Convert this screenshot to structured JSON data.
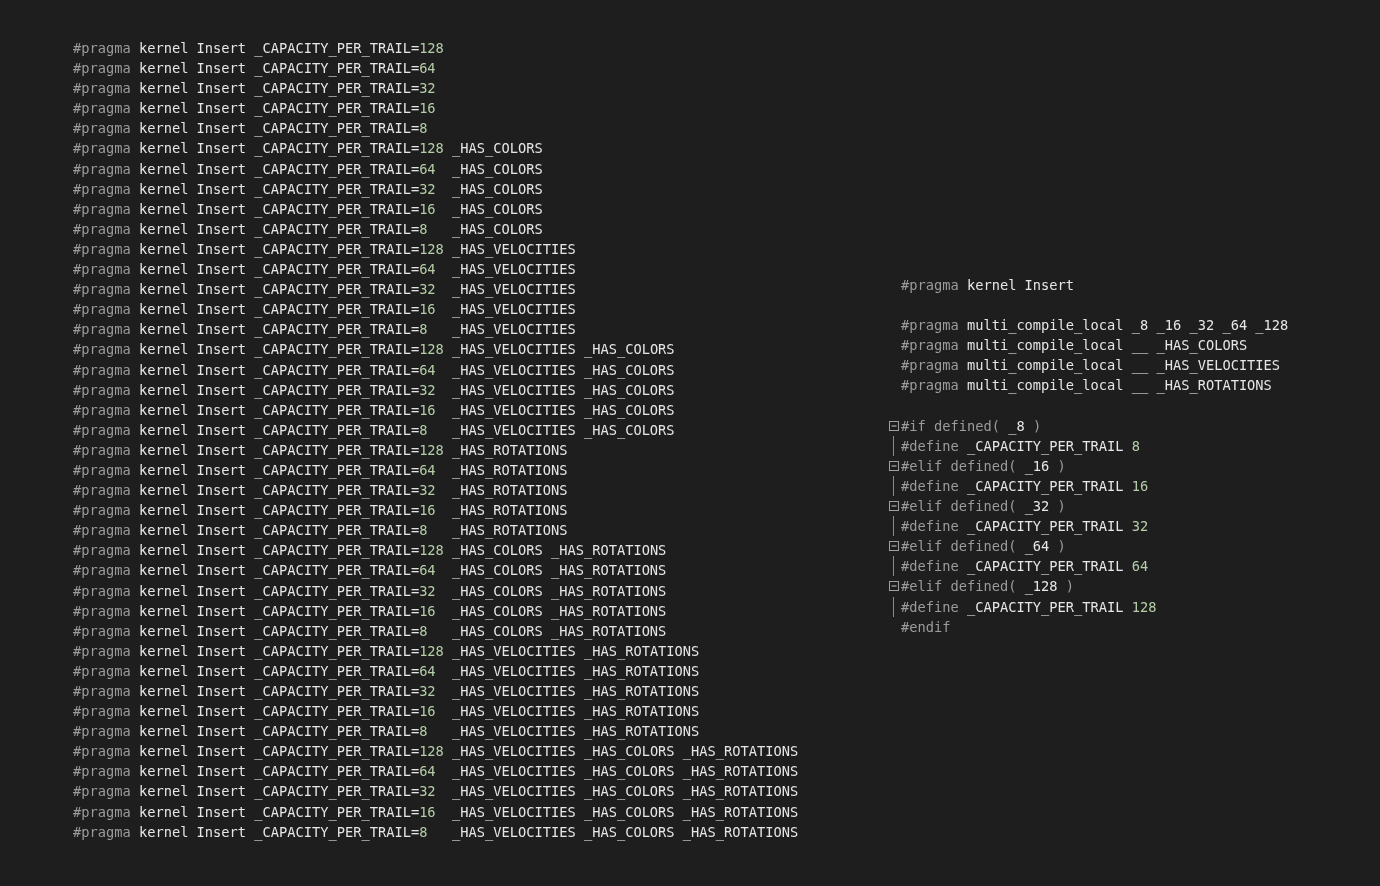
{
  "left_code": {
    "lines": [
      {
        "head": "#pragma",
        "text": "kernel Insert _CAPACITY_PER_TRAIL=",
        "value": "128"
      },
      {
        "head": "#pragma",
        "text": "kernel Insert _CAPACITY_PER_TRAIL=",
        "value": "64"
      },
      {
        "head": "#pragma",
        "text": "kernel Insert _CAPACITY_PER_TRAIL=",
        "value": "32"
      },
      {
        "head": "#pragma",
        "text": "kernel Insert _CAPACITY_PER_TRAIL=",
        "value": "16"
      },
      {
        "head": "#pragma",
        "text": "kernel Insert _CAPACITY_PER_TRAIL=",
        "value": "8"
      },
      {
        "head": "#pragma",
        "text": "kernel Insert _CAPACITY_PER_TRAIL=",
        "value": "128",
        "flags": "_HAS_COLORS"
      },
      {
        "head": "#pragma",
        "text": "kernel Insert _CAPACITY_PER_TRAIL=",
        "value": "64",
        "flags": "_HAS_COLORS"
      },
      {
        "head": "#pragma",
        "text": "kernel Insert _CAPACITY_PER_TRAIL=",
        "value": "32",
        "flags": "_HAS_COLORS"
      },
      {
        "head": "#pragma",
        "text": "kernel Insert _CAPACITY_PER_TRAIL=",
        "value": "16",
        "flags": "_HAS_COLORS"
      },
      {
        "head": "#pragma",
        "text": "kernel Insert _CAPACITY_PER_TRAIL=",
        "value": "8",
        "flags": "_HAS_COLORS"
      },
      {
        "head": "#pragma",
        "text": "kernel Insert _CAPACITY_PER_TRAIL=",
        "value": "128",
        "flags": "_HAS_VELOCITIES"
      },
      {
        "head": "#pragma",
        "text": "kernel Insert _CAPACITY_PER_TRAIL=",
        "value": "64",
        "flags": "_HAS_VELOCITIES"
      },
      {
        "head": "#pragma",
        "text": "kernel Insert _CAPACITY_PER_TRAIL=",
        "value": "32",
        "flags": "_HAS_VELOCITIES"
      },
      {
        "head": "#pragma",
        "text": "kernel Insert _CAPACITY_PER_TRAIL=",
        "value": "16",
        "flags": "_HAS_VELOCITIES"
      },
      {
        "head": "#pragma",
        "text": "kernel Insert _CAPACITY_PER_TRAIL=",
        "value": "8",
        "flags": "_HAS_VELOCITIES"
      },
      {
        "head": "#pragma",
        "text": "kernel Insert _CAPACITY_PER_TRAIL=",
        "value": "128",
        "flags": "_HAS_VELOCITIES _HAS_COLORS"
      },
      {
        "head": "#pragma",
        "text": "kernel Insert _CAPACITY_PER_TRAIL=",
        "value": "64",
        "flags": "_HAS_VELOCITIES _HAS_COLORS"
      },
      {
        "head": "#pragma",
        "text": "kernel Insert _CAPACITY_PER_TRAIL=",
        "value": "32",
        "flags": "_HAS_VELOCITIES _HAS_COLORS"
      },
      {
        "head": "#pragma",
        "text": "kernel Insert _CAPACITY_PER_TRAIL=",
        "value": "16",
        "flags": "_HAS_VELOCITIES _HAS_COLORS"
      },
      {
        "head": "#pragma",
        "text": "kernel Insert _CAPACITY_PER_TRAIL=",
        "value": "8",
        "flags": "_HAS_VELOCITIES _HAS_COLORS"
      },
      {
        "head": "#pragma",
        "text": "kernel Insert _CAPACITY_PER_TRAIL=",
        "value": "128",
        "flags": "_HAS_ROTATIONS"
      },
      {
        "head": "#pragma",
        "text": "kernel Insert _CAPACITY_PER_TRAIL=",
        "value": "64",
        "flags": "_HAS_ROTATIONS"
      },
      {
        "head": "#pragma",
        "text": "kernel Insert _CAPACITY_PER_TRAIL=",
        "value": "32",
        "flags": "_HAS_ROTATIONS"
      },
      {
        "head": "#pragma",
        "text": "kernel Insert _CAPACITY_PER_TRAIL=",
        "value": "16",
        "flags": "_HAS_ROTATIONS"
      },
      {
        "head": "#pragma",
        "text": "kernel Insert _CAPACITY_PER_TRAIL=",
        "value": "8",
        "flags": "_HAS_ROTATIONS"
      },
      {
        "head": "#pragma",
        "text": "kernel Insert _CAPACITY_PER_TRAIL=",
        "value": "128",
        "flags": "_HAS_COLORS _HAS_ROTATIONS"
      },
      {
        "head": "#pragma",
        "text": "kernel Insert _CAPACITY_PER_TRAIL=",
        "value": "64",
        "flags": "_HAS_COLORS _HAS_ROTATIONS"
      },
      {
        "head": "#pragma",
        "text": "kernel Insert _CAPACITY_PER_TRAIL=",
        "value": "32",
        "flags": "_HAS_COLORS _HAS_ROTATIONS"
      },
      {
        "head": "#pragma",
        "text": "kernel Insert _CAPACITY_PER_TRAIL=",
        "value": "16",
        "flags": "_HAS_COLORS _HAS_ROTATIONS"
      },
      {
        "head": "#pragma",
        "text": "kernel Insert _CAPACITY_PER_TRAIL=",
        "value": "8",
        "flags": "_HAS_COLORS _HAS_ROTATIONS"
      },
      {
        "head": "#pragma",
        "text": "kernel Insert _CAPACITY_PER_TRAIL=",
        "value": "128",
        "flags": "_HAS_VELOCITIES _HAS_ROTATIONS"
      },
      {
        "head": "#pragma",
        "text": "kernel Insert _CAPACITY_PER_TRAIL=",
        "value": "64",
        "flags": "_HAS_VELOCITIES _HAS_ROTATIONS"
      },
      {
        "head": "#pragma",
        "text": "kernel Insert _CAPACITY_PER_TRAIL=",
        "value": "32",
        "flags": "_HAS_VELOCITIES _HAS_ROTATIONS"
      },
      {
        "head": "#pragma",
        "text": "kernel Insert _CAPACITY_PER_TRAIL=",
        "value": "16",
        "flags": "_HAS_VELOCITIES _HAS_ROTATIONS"
      },
      {
        "head": "#pragma",
        "text": "kernel Insert _CAPACITY_PER_TRAIL=",
        "value": "8",
        "flags": "_HAS_VELOCITIES _HAS_ROTATIONS"
      },
      {
        "head": "#pragma",
        "text": "kernel Insert _CAPACITY_PER_TRAIL=",
        "value": "128",
        "flags": "_HAS_VELOCITIES _HAS_COLORS _HAS_ROTATIONS"
      },
      {
        "head": "#pragma",
        "text": "kernel Insert _CAPACITY_PER_TRAIL=",
        "value": "64",
        "flags": "_HAS_VELOCITIES _HAS_COLORS _HAS_ROTATIONS"
      },
      {
        "head": "#pragma",
        "text": "kernel Insert _CAPACITY_PER_TRAIL=",
        "value": "32",
        "flags": "_HAS_VELOCITIES _HAS_COLORS _HAS_ROTATIONS"
      },
      {
        "head": "#pragma",
        "text": "kernel Insert _CAPACITY_PER_TRAIL=",
        "value": "16",
        "flags": "_HAS_VELOCITIES _HAS_COLORS _HAS_ROTATIONS"
      },
      {
        "head": "#pragma",
        "text": "kernel Insert _CAPACITY_PER_TRAIL=",
        "value": "8",
        "flags": "_HAS_VELOCITIES _HAS_COLORS _HAS_ROTATIONS"
      }
    ]
  },
  "right_code": {
    "lines": [
      {
        "kind": "plain",
        "tokens": [
          {
            "kind": "directive",
            "text": "#pragma"
          },
          {
            "kind": "identifier",
            "text": "kernel Insert"
          }
        ]
      },
      {
        "kind": "blank"
      },
      {
        "kind": "plain",
        "tokens": [
          {
            "kind": "directive",
            "text": "#pragma"
          },
          {
            "kind": "identifier",
            "text": "multi_compile_local _8 _16 _32 _64 _128"
          }
        ]
      },
      {
        "kind": "plain",
        "tokens": [
          {
            "kind": "directive",
            "text": "#pragma"
          },
          {
            "kind": "identifier",
            "text": "multi_compile_local __ _HAS_COLORS"
          }
        ]
      },
      {
        "kind": "plain",
        "tokens": [
          {
            "kind": "directive",
            "text": "#pragma"
          },
          {
            "kind": "identifier",
            "text": "multi_compile_local __ _HAS_VELOCITIES"
          }
        ]
      },
      {
        "kind": "plain",
        "tokens": [
          {
            "kind": "directive",
            "text": "#pragma"
          },
          {
            "kind": "identifier",
            "text": "multi_compile_local __ _HAS_ROTATIONS"
          }
        ]
      },
      {
        "kind": "blank"
      },
      {
        "kind": "fold",
        "expanded": true,
        "tokens": [
          {
            "kind": "directive",
            "text": "#if defined("
          },
          {
            "kind": "identifier",
            "text": "_8"
          },
          {
            "kind": "directive",
            "text": ")"
          }
        ]
      },
      {
        "kind": "body",
        "tokens": [
          {
            "kind": "directive",
            "text": "#define"
          },
          {
            "kind": "identifier",
            "text": "_CAPACITY_PER_TRAIL"
          },
          {
            "kind": "number",
            "text": "8"
          }
        ]
      },
      {
        "kind": "fold",
        "expanded": true,
        "tokens": [
          {
            "kind": "directive",
            "text": "#elif defined("
          },
          {
            "kind": "identifier",
            "text": "_16"
          },
          {
            "kind": "directive",
            "text": ")"
          }
        ]
      },
      {
        "kind": "body",
        "tokens": [
          {
            "kind": "directive",
            "text": "#define"
          },
          {
            "kind": "identifier",
            "text": "_CAPACITY_PER_TRAIL"
          },
          {
            "kind": "number",
            "text": "16"
          }
        ]
      },
      {
        "kind": "fold",
        "expanded": true,
        "tokens": [
          {
            "kind": "directive",
            "text": "#elif defined("
          },
          {
            "kind": "identifier",
            "text": "_32"
          },
          {
            "kind": "directive",
            "text": ")"
          }
        ]
      },
      {
        "kind": "body",
        "tokens": [
          {
            "kind": "directive",
            "text": "#define"
          },
          {
            "kind": "identifier",
            "text": "_CAPACITY_PER_TRAIL"
          },
          {
            "kind": "number",
            "text": "32"
          }
        ]
      },
      {
        "kind": "fold",
        "expanded": true,
        "tokens": [
          {
            "kind": "directive",
            "text": "#elif defined("
          },
          {
            "kind": "identifier",
            "text": "_64"
          },
          {
            "kind": "directive",
            "text": ")"
          }
        ]
      },
      {
        "kind": "body",
        "tokens": [
          {
            "kind": "directive",
            "text": "#define"
          },
          {
            "kind": "identifier",
            "text": "_CAPACITY_PER_TRAIL"
          },
          {
            "kind": "number",
            "text": "64"
          }
        ]
      },
      {
        "kind": "fold",
        "expanded": true,
        "tokens": [
          {
            "kind": "directive",
            "text": "#elif defined("
          },
          {
            "kind": "identifier",
            "text": "_128"
          },
          {
            "kind": "directive",
            "text": ")"
          }
        ]
      },
      {
        "kind": "body",
        "tokens": [
          {
            "kind": "directive",
            "text": "#define"
          },
          {
            "kind": "identifier",
            "text": "_CAPACITY_PER_TRAIL"
          },
          {
            "kind": "number",
            "text": "128"
          }
        ]
      },
      {
        "kind": "plain",
        "tokens": [
          {
            "kind": "directive",
            "text": "#endif"
          }
        ]
      }
    ]
  }
}
